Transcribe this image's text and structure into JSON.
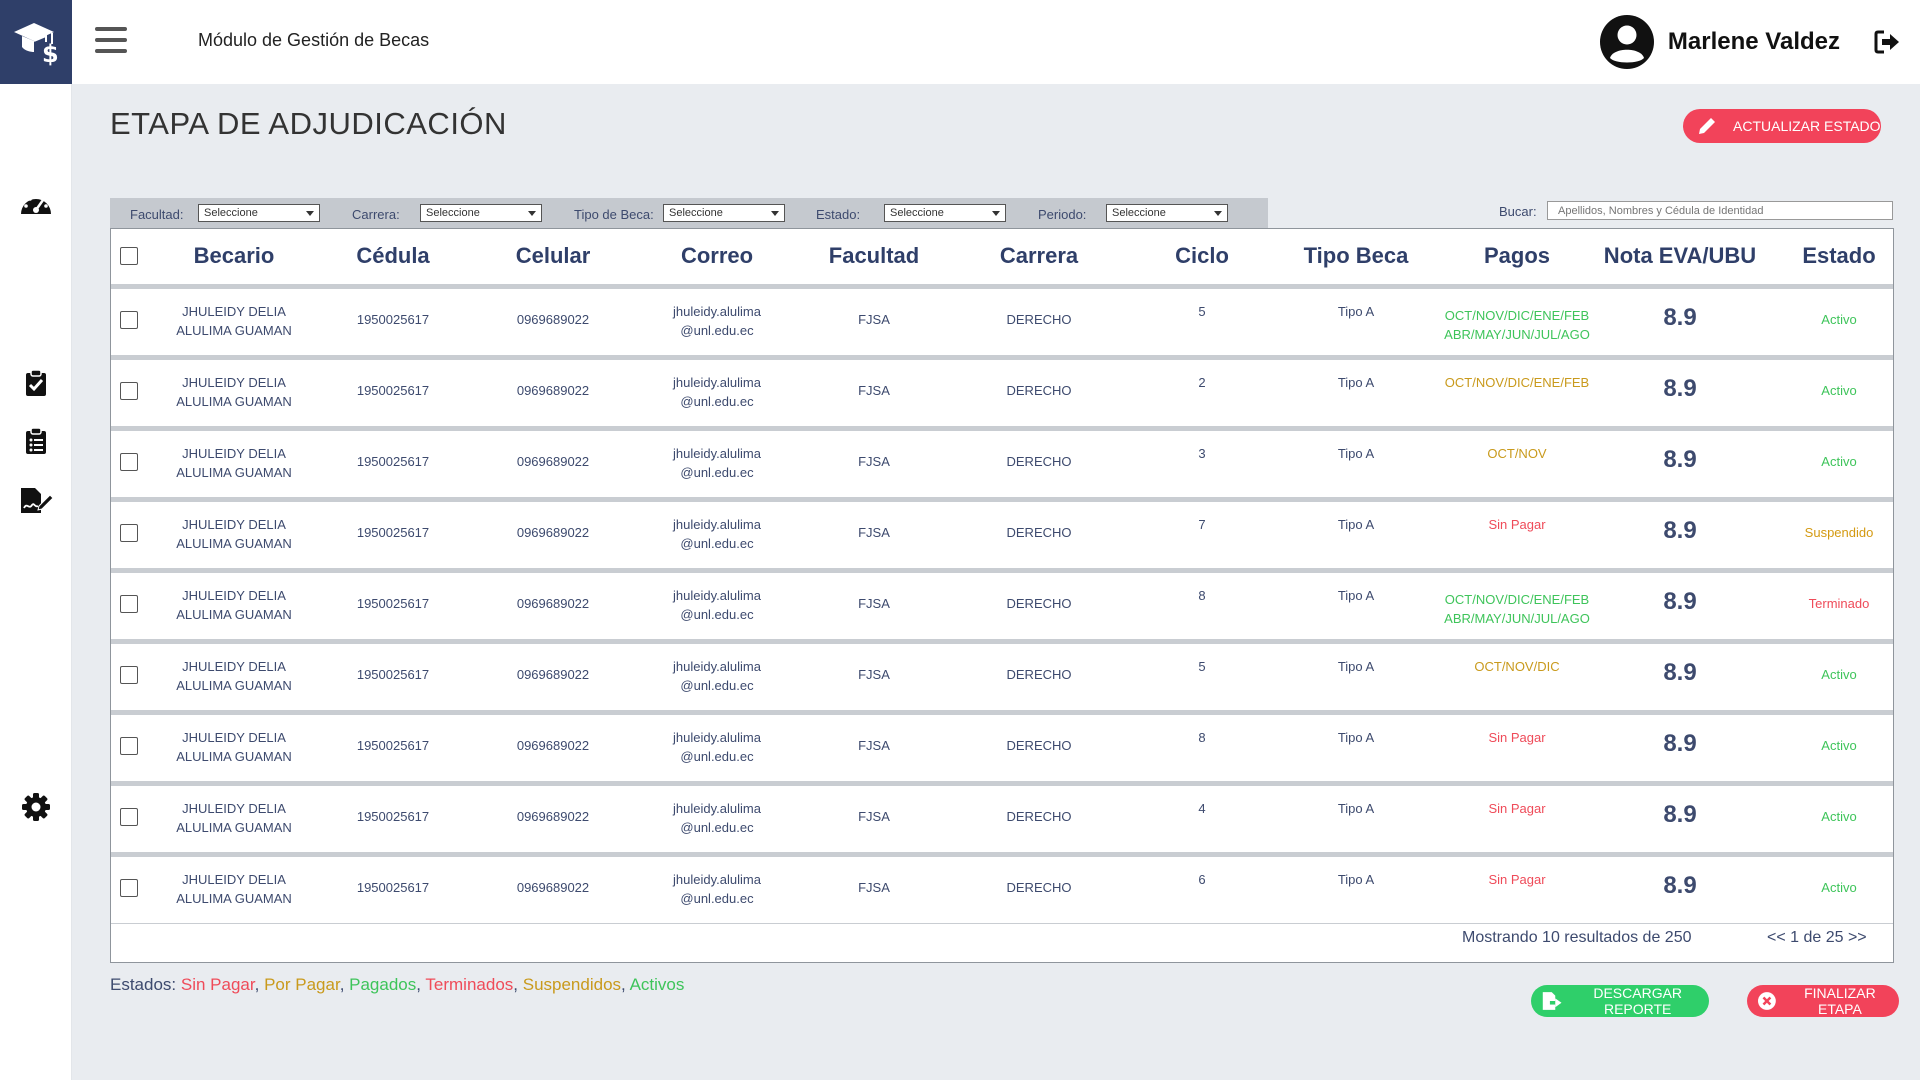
{
  "app": {
    "module_title": "Módulo de Gestión de Becas",
    "user_name": "Marlene Valdez"
  },
  "page": {
    "title": "ETAPA DE ADJUDICACIÓN",
    "update_button": "ACTUALIZAR ESTADO",
    "download_button": "DESCARGAR REPORTE",
    "finish_button": "FINALIZAR ETAPA"
  },
  "filters": {
    "facultad": {
      "label": "Facultad:",
      "value": "Seleccione"
    },
    "carrera": {
      "label": "Carrera:",
      "value": "Seleccione"
    },
    "tipo_beca": {
      "label": "Tipo de Beca:",
      "value": "Seleccione"
    },
    "estado": {
      "label": "Estado:",
      "value": "Seleccione"
    },
    "periodo": {
      "label": "Periodo:",
      "value": "Seleccione"
    },
    "search_label": "Bucar:",
    "search_placeholder": "Apellidos, Nombres y Cédula de Identidad"
  },
  "table": {
    "columns": [
      "Becario",
      "Cédula",
      "Celular",
      "Correo",
      "Facultad",
      "Carrera",
      "Ciclo",
      "Tipo Beca",
      "Pagos",
      "Nota EVA/UBU",
      "Estado"
    ],
    "rows": [
      {
        "becario": [
          "JHULEIDY DELIA",
          "ALULIMA GUAMAN"
        ],
        "cedula": "1950025617",
        "celular": "0969689022",
        "correo": [
          "jhuleidy.alulima",
          "@unl.edu.ec"
        ],
        "facultad": "FJSA",
        "carrera": "DERECHO",
        "ciclo": "5",
        "tipo": "Tipo A",
        "pagos": [
          "OCT/NOV/DIC/ENE/FEB",
          "ABR/MAY/JUN/JUL/AGO"
        ],
        "pagos_color": "#3ec45a",
        "nota": "8.9",
        "estado": "Activo",
        "estado_color": "#3ec45a"
      },
      {
        "becario": [
          "JHULEIDY DELIA",
          "ALULIMA GUAMAN"
        ],
        "cedula": "1950025617",
        "celular": "0969689022",
        "correo": [
          "jhuleidy.alulima",
          "@unl.edu.ec"
        ],
        "facultad": "FJSA",
        "carrera": "DERECHO",
        "ciclo": "2",
        "tipo": "Tipo A",
        "pagos": [
          "OCT/NOV/DIC/ENE/FEB"
        ],
        "pagos_color": "#c99a1c",
        "nota": "8.9",
        "estado": "Activo",
        "estado_color": "#3ec45a"
      },
      {
        "becario": [
          "JHULEIDY DELIA",
          "ALULIMA GUAMAN"
        ],
        "cedula": "1950025617",
        "celular": "0969689022",
        "correo": [
          "jhuleidy.alulima",
          "@unl.edu.ec"
        ],
        "facultad": "FJSA",
        "carrera": "DERECHO",
        "ciclo": "3",
        "tipo": "Tipo A",
        "pagos": [
          "OCT/NOV"
        ],
        "pagos_color": "#c99a1c",
        "nota": "8.9",
        "estado": "Activo",
        "estado_color": "#3ec45a"
      },
      {
        "becario": [
          "JHULEIDY DELIA",
          "ALULIMA GUAMAN"
        ],
        "cedula": "1950025617",
        "celular": "0969689022",
        "correo": [
          "jhuleidy.alulima",
          "@unl.edu.ec"
        ],
        "facultad": "FJSA",
        "carrera": "DERECHO",
        "ciclo": "7",
        "tipo": "Tipo A",
        "pagos": [
          "Sin Pagar"
        ],
        "pagos_color": "#ef4b59",
        "nota": "8.9",
        "estado": "Suspendido",
        "estado_color": "#d49a12"
      },
      {
        "becario": [
          "JHULEIDY DELIA",
          "ALULIMA GUAMAN"
        ],
        "cedula": "1950025617",
        "celular": "0969689022",
        "correo": [
          "jhuleidy.alulima",
          "@unl.edu.ec"
        ],
        "facultad": "FJSA",
        "carrera": "DERECHO",
        "ciclo": "8",
        "tipo": "Tipo A",
        "pagos": [
          "OCT/NOV/DIC/ENE/FEB",
          "ABR/MAY/JUN/JUL/AGO"
        ],
        "pagos_color": "#3ec45a",
        "nota": "8.9",
        "estado": "Terminado",
        "estado_color": "#ef4b59"
      },
      {
        "becario": [
          "JHULEIDY DELIA",
          "ALULIMA GUAMAN"
        ],
        "cedula": "1950025617",
        "celular": "0969689022",
        "correo": [
          "jhuleidy.alulima",
          "@unl.edu.ec"
        ],
        "facultad": "FJSA",
        "carrera": "DERECHO",
        "ciclo": "5",
        "tipo": "Tipo A",
        "pagos": [
          "OCT/NOV/DIC"
        ],
        "pagos_color": "#c99a1c",
        "nota": "8.9",
        "estado": "Activo",
        "estado_color": "#3ec45a"
      },
      {
        "becario": [
          "JHULEIDY DELIA",
          "ALULIMA GUAMAN"
        ],
        "cedula": "1950025617",
        "celular": "0969689022",
        "correo": [
          "jhuleidy.alulima",
          "@unl.edu.ec"
        ],
        "facultad": "FJSA",
        "carrera": "DERECHO",
        "ciclo": "8",
        "tipo": "Tipo A",
        "pagos": [
          "Sin Pagar"
        ],
        "pagos_color": "#ef4b59",
        "nota": "8.9",
        "estado": "Activo",
        "estado_color": "#3ec45a"
      },
      {
        "becario": [
          "JHULEIDY DELIA",
          "ALULIMA GUAMAN"
        ],
        "cedula": "1950025617",
        "celular": "0969689022",
        "correo": [
          "jhuleidy.alulima",
          "@unl.edu.ec"
        ],
        "facultad": "FJSA",
        "carrera": "DERECHO",
        "ciclo": "4",
        "tipo": "Tipo A",
        "pagos": [
          "Sin Pagar"
        ],
        "pagos_color": "#ef4b59",
        "nota": "8.9",
        "estado": "Activo",
        "estado_color": "#3ec45a"
      },
      {
        "becario": [
          "JHULEIDY DELIA",
          "ALULIMA GUAMAN"
        ],
        "cedula": "1950025617",
        "celular": "0969689022",
        "correo": [
          "jhuleidy.alulima",
          "@unl.edu.ec"
        ],
        "facultad": "FJSA",
        "carrera": "DERECHO",
        "ciclo": "6",
        "tipo": "Tipo A",
        "pagos": [
          "Sin Pagar"
        ],
        "pagos_color": "#ef4b59",
        "nota": "8.9",
        "estado": "Activo",
        "estado_color": "#3ec45a"
      }
    ],
    "footer_results": "Mostrando 10 resultados de 250",
    "pagination": "<< 1 de 25 >>"
  },
  "legend": {
    "label": "Estados:",
    "items": [
      {
        "text": "Sin Pagar",
        "color": "#ef4b59"
      },
      {
        "text": "Por Pagar",
        "color": "#c99a1c"
      },
      {
        "text": "Pagados",
        "color": "#3ec45a"
      },
      {
        "text": "Terminados",
        "color": "#ef4b59"
      },
      {
        "text": "Suspendidos",
        "color": "#c99a1c"
      },
      {
        "text": "Activos",
        "color": "#3ec45a"
      }
    ]
  },
  "icons": [
    "graduation-cap-dollar-icon",
    "hamburger-icon",
    "speedometer-icon",
    "clipboard-check-icon",
    "clipboard-list-icon",
    "file-signature-icon",
    "gear-icon",
    "user-avatar-icon",
    "logout-icon",
    "pencil-icon",
    "file-export-icon",
    "times-circle-icon"
  ],
  "colors": {
    "brand": "#2f3f69",
    "primary_text": "#3d4a6e",
    "danger": "#f2435a",
    "success": "#2fcf6a"
  }
}
